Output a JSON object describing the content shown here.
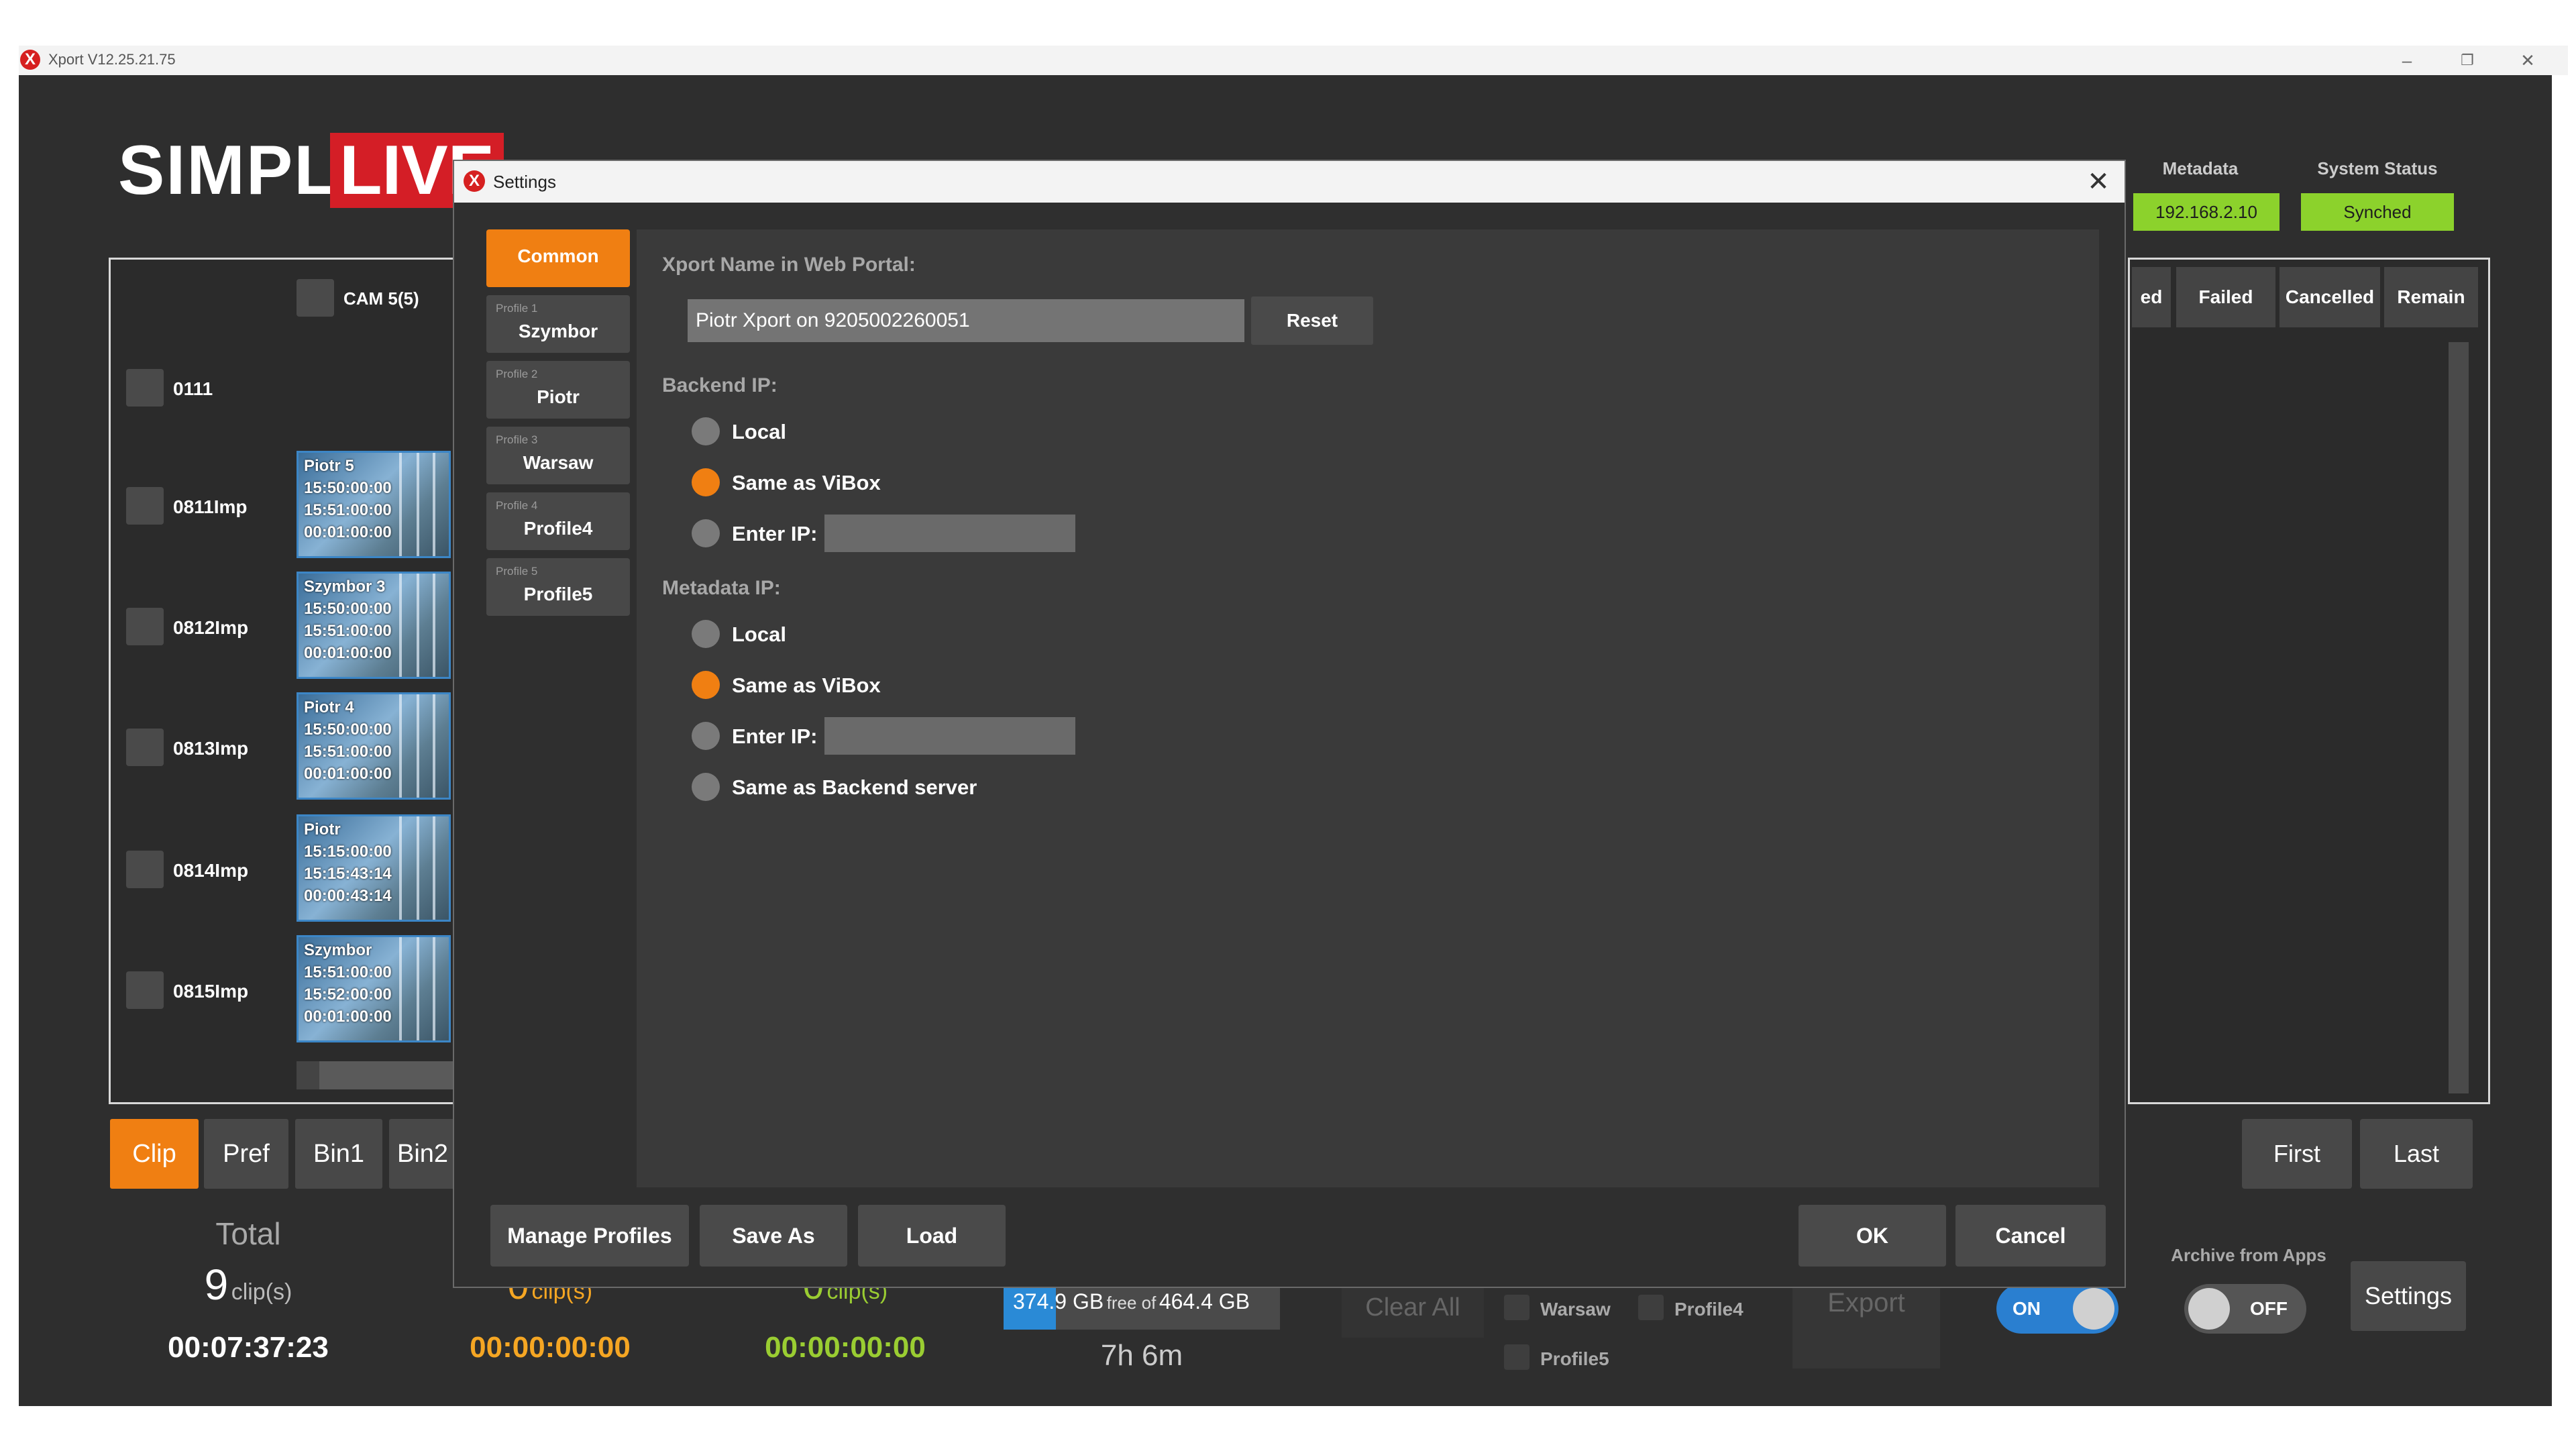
{
  "window": {
    "title": "Xport V12.25.21.75",
    "minimize_glyph": "–",
    "restore_glyph": "❐",
    "close_glyph": "✕",
    "logo_glyph": "X"
  },
  "brand": {
    "simply": "SIMPLY",
    "live": "LIVE"
  },
  "header": {
    "metadata_label": "Metadata",
    "metadata_value": "192.168.2.10",
    "system_status_label": "System Status",
    "system_status_value": "Synched",
    "status_color": "#8cd22c"
  },
  "clip_panel": {
    "camera": "CAM 5(5)",
    "rows": [
      {
        "label": "0111"
      },
      {
        "label": "0811Imp",
        "clip": {
          "name": "Piotr 5",
          "in": "15:50:00:00",
          "out": "15:51:00:00",
          "dur": "00:01:00:00"
        }
      },
      {
        "label": "0812Imp",
        "clip": {
          "name": "Szymbor 3",
          "in": "15:50:00:00",
          "out": "15:51:00:00",
          "dur": "00:01:00:00"
        }
      },
      {
        "label": "0813Imp",
        "clip": {
          "name": "Piotr 4",
          "in": "15:50:00:00",
          "out": "15:51:00:00",
          "dur": "00:01:00:00"
        }
      },
      {
        "label": "0814Imp",
        "clip": {
          "name": "Piotr",
          "in": "15:15:00:00",
          "out": "15:15:43:14",
          "dur": "00:00:43:14"
        }
      },
      {
        "label": "0815Imp",
        "clip": {
          "name": "Szymbor",
          "in": "15:51:00:00",
          "out": "15:52:00:00",
          "dur": "00:01:00:00"
        }
      }
    ]
  },
  "right_panel": {
    "columns": [
      "ed",
      "Failed",
      "Cancelled",
      "Remain"
    ]
  },
  "tabs": [
    "Clip",
    "Pref",
    "Bin1",
    "Bin2"
  ],
  "nav": {
    "first": "First",
    "last": "Last"
  },
  "summary": {
    "total_label": "Total",
    "total_count": "9",
    "clips_unit": "clip(s)",
    "total_time": "00:07:37:23",
    "orange_count": "0",
    "orange_time": "00:00:00:00",
    "green_count": "0",
    "green_time": "00:00:00:00",
    "storage_free": "374.9 GB",
    "storage_free_of": "free of",
    "storage_total": "464.4 GB",
    "storage_used_fraction": 0.19,
    "storage_time": "7h 6m",
    "clear_all": "Clear All",
    "export": "Export",
    "profile_checks": [
      "Warsaw",
      "Profile4",
      "Profile5"
    ],
    "on_label": "ON",
    "archive_label": "Archive from Apps",
    "off_label": "OFF",
    "settings": "Settings",
    "orange_color": "#f5a623",
    "green_color": "#9acd32"
  },
  "dialog": {
    "title": "Settings",
    "close_glyph": "✕",
    "profiles": [
      {
        "sub": "",
        "name": "Common",
        "active": true
      },
      {
        "sub": "Profile 1",
        "name": "Szymbor"
      },
      {
        "sub": "Profile 2",
        "name": "Piotr"
      },
      {
        "sub": "Profile 3",
        "name": "Warsaw"
      },
      {
        "sub": "Profile 4",
        "name": "Profile4"
      },
      {
        "sub": "Profile 5",
        "name": "Profile5"
      }
    ],
    "xport_name_label": "Xport Name in Web Portal:",
    "xport_name_value": "Piotr Xport on 9205002260051",
    "reset": "Reset",
    "backend_label": "Backend IP:",
    "backend_options": [
      {
        "label": "Local",
        "selected": false
      },
      {
        "label": "Same as ViBox",
        "selected": true
      },
      {
        "label": "Enter IP:",
        "selected": false,
        "input": ""
      }
    ],
    "metadata_label": "Metadata IP:",
    "metadata_options": [
      {
        "label": "Local",
        "selected": false
      },
      {
        "label": "Same as ViBox",
        "selected": true
      },
      {
        "label": "Enter IP:",
        "selected": false,
        "input": ""
      },
      {
        "label": "Same as Backend server",
        "selected": false
      }
    ],
    "buttons": {
      "manage": "Manage Profiles",
      "save_as": "Save As",
      "load": "Load",
      "ok": "OK",
      "cancel": "Cancel"
    },
    "accent": "#f07f12"
  }
}
